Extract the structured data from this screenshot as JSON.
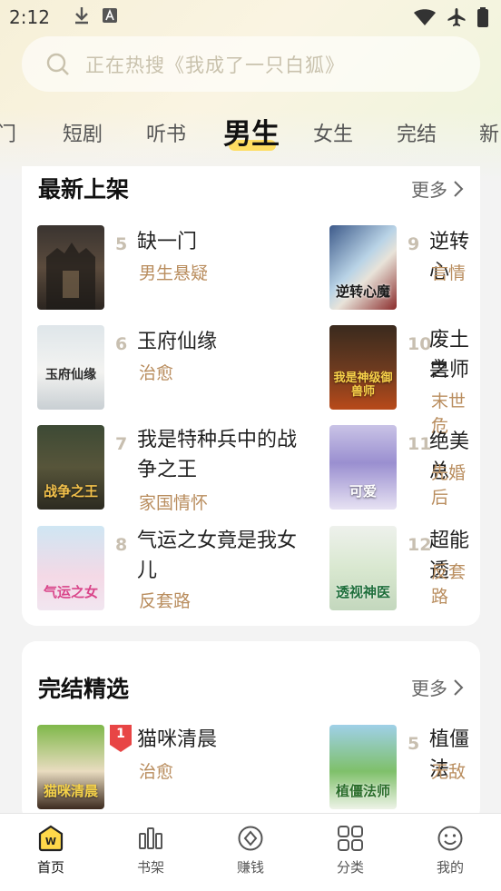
{
  "status_bar": {
    "time": "2:12",
    "icons": [
      "download-icon",
      "a-letter-icon",
      "wifi-icon",
      "airplane-icon",
      "battery-icon"
    ]
  },
  "search": {
    "placeholder": "正在热搜《我成了一只白狐》"
  },
  "tabs": [
    {
      "label": "门"
    },
    {
      "label": "短剧"
    },
    {
      "label": "听书"
    },
    {
      "label": "男生",
      "active": true
    },
    {
      "label": "女生"
    },
    {
      "label": "完结"
    },
    {
      "label": "新"
    }
  ],
  "accent_color": "#ffd84a",
  "genre_color": "#b98d5e",
  "new_section": {
    "title": "最新上架",
    "more": "更多",
    "books": [
      {
        "rank": "5",
        "title": "缺一门",
        "genre": "男生悬疑",
        "cover_text": ""
      },
      {
        "rank": "6",
        "title": "玉府仙缘",
        "genre": "治愈",
        "cover_text": "玉府仙缘"
      },
      {
        "rank": "7",
        "title_line1": "我是特种兵中的战",
        "title_line2": "争之王",
        "genre": "家国情怀",
        "cover_text": "战争之王"
      },
      {
        "rank": "8",
        "title_line1": "气运之女竟是我女",
        "title_line2": "儿",
        "genre": "反套路",
        "cover_text": "气运之女"
      },
      {
        "rank": "9",
        "title": "逆转心",
        "genre": "言情",
        "cover_text": "逆转心魔"
      },
      {
        "rank": "10",
        "title_line1": "废土之",
        "title_line2": "兽师",
        "genre": "末世危",
        "cover_text": "我是神级御兽师"
      },
      {
        "rank": "11",
        "title": "绝美总",
        "genre": "先婚后",
        "cover_text": "可爱"
      },
      {
        "rank": "12",
        "title": "超能透",
        "genre": "反套路",
        "cover_text": "透视神医"
      }
    ]
  },
  "complete_section": {
    "title": "完结精选",
    "more": "更多",
    "books": [
      {
        "rank": "1",
        "title": "猫咪清晨",
        "genre": "治愈",
        "cover_text": "猫咪清晨"
      },
      {
        "rank": "5",
        "title": "植僵法",
        "genre": "无敌",
        "cover_text": "植僵法师"
      }
    ]
  },
  "bottom_nav": [
    {
      "label": "首页",
      "icon": "home-icon",
      "active": true
    },
    {
      "label": "书架",
      "icon": "bookshelf-icon"
    },
    {
      "label": "赚钱",
      "icon": "coin-icon"
    },
    {
      "label": "分类",
      "icon": "category-icon"
    },
    {
      "label": "我的",
      "icon": "profile-icon"
    }
  ]
}
